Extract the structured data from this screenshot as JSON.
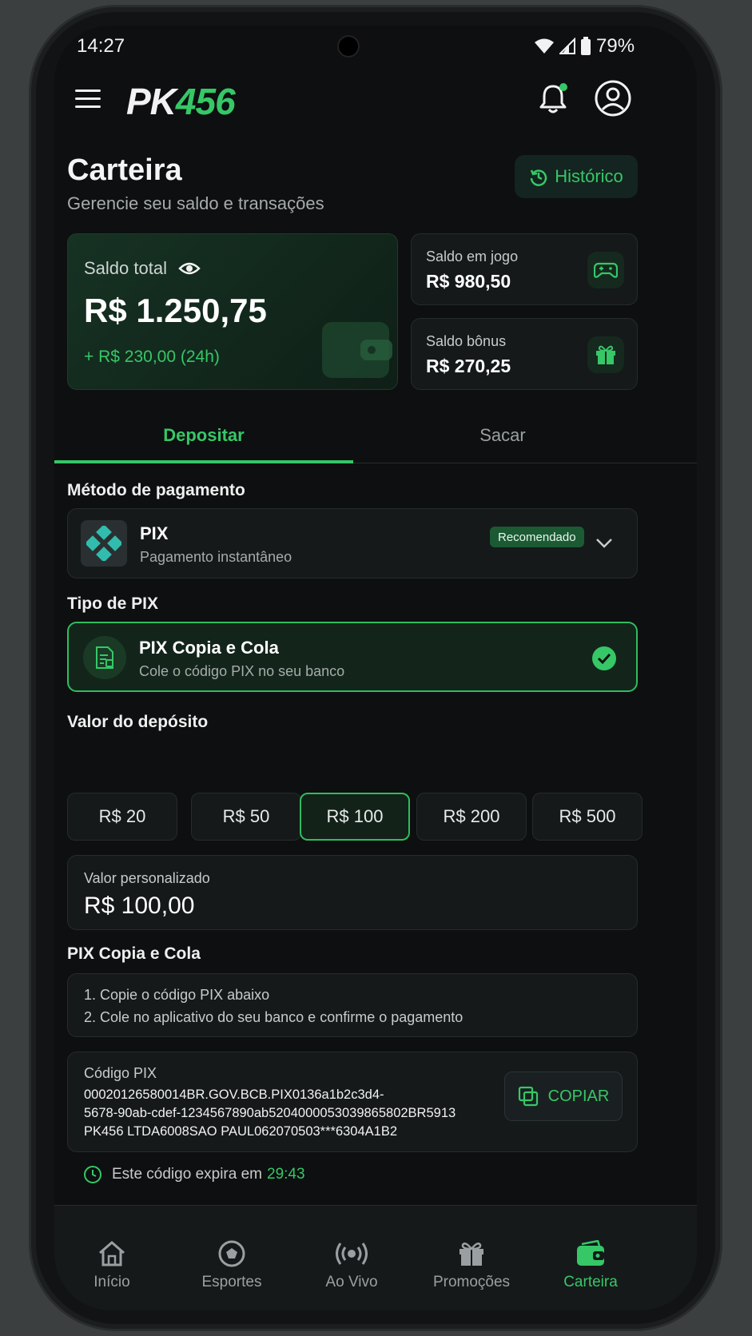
{
  "status_bar": {
    "time": "14:27",
    "battery": "79%"
  },
  "header": {
    "logo_pk": "PK",
    "logo_num": "456"
  },
  "page": {
    "title": "Carteira",
    "subtitle": "Gerencie seu saldo e transações",
    "history_label": "Histórico"
  },
  "balances": {
    "total_label": "Saldo total",
    "total_value": "R$ 1.250,75",
    "change": "+ R$ 230,00 (24h)",
    "in_game_label": "Saldo em jogo",
    "in_game_value": "R$ 980,50",
    "bonus_label": "Saldo bônus",
    "bonus_value": "R$ 270,25"
  },
  "tabs": [
    {
      "label": "Depositar",
      "active": true
    },
    {
      "label": "Sacar",
      "active": false
    }
  ],
  "payment": {
    "section_label": "Método de pagamento",
    "method_name": "PIX",
    "method_desc": "Pagamento instantâneo",
    "badge": "Recomendado"
  },
  "pix_type": {
    "section_label": "Tipo de PIX",
    "name": "PIX Copia e Cola",
    "desc": "Cole o código PIX no seu banco"
  },
  "deposit": {
    "section_label": "Valor do depósito",
    "amounts": [
      "R$ 20",
      "R$ 50",
      "R$ 100",
      "R$ 200",
      "R$ 500"
    ],
    "selected_index": 2,
    "custom_label": "Valor personalizado",
    "custom_value": "R$ 100,00"
  },
  "pix_copy": {
    "section_label": "PIX Copia e Cola",
    "step1": "1. Copie o código PIX abaixo",
    "step2": "2. Cole no aplicativo do seu banco e confirme o pagamento",
    "code_label": "Código PIX",
    "code_line1": "00020126580014BR.GOV.BCB.PIX0136a1b2c3d4-",
    "code_line2": "5678-90ab-cdef-1234567890ab5204000053039865802BR5913",
    "code_line3": "PK456 LTDA6008SAO PAUL062070503***6304A1B2",
    "copy_label": "COPIAR",
    "expires_text": "Este código expira em",
    "expires_time": "29:43"
  },
  "bottom_nav": [
    {
      "label": "Início",
      "icon": "home-icon"
    },
    {
      "label": "Esportes",
      "icon": "soccer-ball-icon"
    },
    {
      "label": "Ao Vivo",
      "icon": "live-broadcast-icon"
    },
    {
      "label": "Promoções",
      "icon": "gift-icon"
    },
    {
      "label": "Carteira",
      "icon": "wallet-icon",
      "active": true
    }
  ],
  "colors": {
    "accent": "#36c767",
    "background": "#0d0f10",
    "card": "#15191a"
  }
}
